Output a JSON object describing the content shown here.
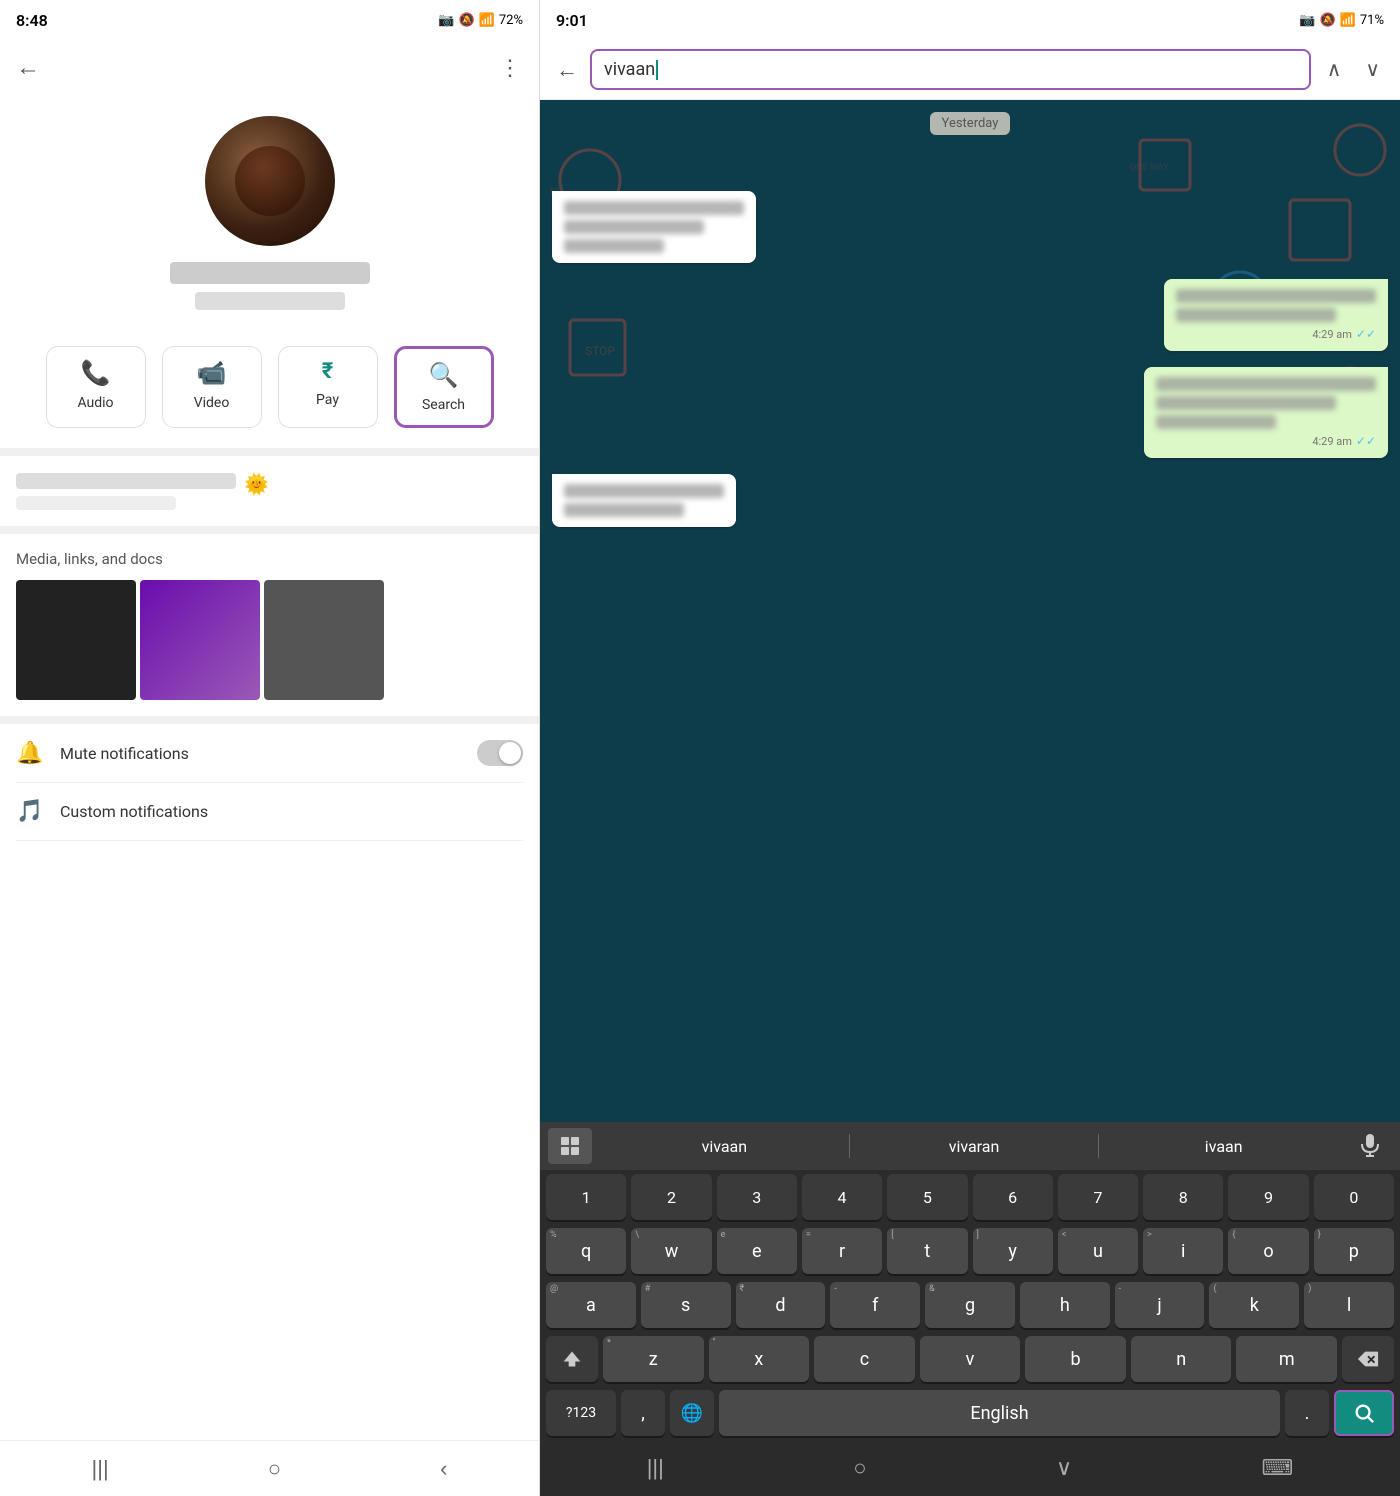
{
  "left": {
    "status_bar": {
      "time": "8:48",
      "battery": "72%",
      "icons": "📷 🔕 📶"
    },
    "actions": [
      {
        "id": "audio",
        "label": "Audio",
        "icon": "📞"
      },
      {
        "id": "video",
        "label": "Video",
        "icon": "📹"
      },
      {
        "id": "pay",
        "label": "Pay",
        "icon": "₹"
      },
      {
        "id": "search",
        "label": "Search",
        "icon": "🔍",
        "highlighted": true
      }
    ],
    "media_title": "Media, links, and docs",
    "settings": [
      {
        "id": "mute",
        "label": "Mute notifications",
        "icon": "🔔",
        "has_toggle": true
      },
      {
        "id": "custom",
        "label": "Custom notifications",
        "icon": "🎵",
        "has_toggle": false
      }
    ]
  },
  "right": {
    "status_bar": {
      "time": "9:01",
      "battery": "71%"
    },
    "search_query": "vivaan",
    "yesterday_label": "Yesterday",
    "messages": [
      {
        "type": "received",
        "time": ""
      },
      {
        "type": "sent",
        "time": "4:29 am",
        "ticks": "✓✓"
      },
      {
        "type": "sent",
        "time": "4:29 am",
        "ticks": "✓✓"
      },
      {
        "type": "received",
        "time": ""
      }
    ],
    "suggestions": [
      "vivaan",
      "vivaran",
      "ivaan"
    ],
    "keyboard": {
      "row1": [
        "1",
        "2",
        "3",
        "4",
        "5",
        "6",
        "7",
        "8",
        "9",
        "0"
      ],
      "row2": [
        "q",
        "w",
        "e",
        "r",
        "t",
        "y",
        "u",
        "i",
        "o",
        "p"
      ],
      "row3": [
        "a",
        "s",
        "d",
        "f",
        "g",
        "h",
        "j",
        "k",
        "l"
      ],
      "row4": [
        "z",
        "x",
        "c",
        "v",
        "b",
        "n",
        "m"
      ],
      "bottom_left": "?123",
      "bottom_comma": ",",
      "bottom_globe": "🌐",
      "bottom_space": "English",
      "bottom_period": ".",
      "bottom_search_label": "search"
    },
    "nav": [
      "|||",
      "○",
      "∨",
      "⌨"
    ]
  }
}
